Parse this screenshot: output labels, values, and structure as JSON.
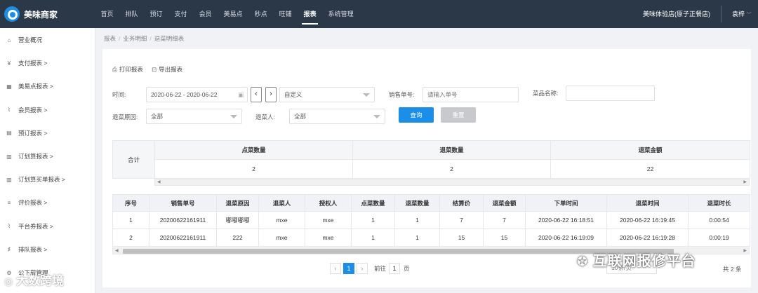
{
  "app": {
    "name": "美味商家"
  },
  "nav": [
    "首页",
    "排队",
    "预订",
    "支付",
    "会员",
    "美易点",
    "秒点",
    "旺铺",
    "报表",
    "系统管理"
  ],
  "nav_active": 8,
  "store_name": "美味体验店(原子正餐店)",
  "user_name": "袁梓",
  "sidebar": [
    {
      "icon": "home-icon",
      "glyph": "⌂",
      "label": "营业概况"
    },
    {
      "icon": "yen-icon",
      "glyph": "¥",
      "label": "支付报表 >"
    },
    {
      "icon": "grid-icon",
      "glyph": "▦",
      "label": "美易点报表 >"
    },
    {
      "icon": "line-chart-icon",
      "glyph": "⌇",
      "label": "会员报表 >"
    },
    {
      "icon": "calendar-icon",
      "glyph": "▤",
      "label": "预订报表 >"
    },
    {
      "icon": "bar-chart-icon",
      "glyph": "▥",
      "label": "订划算报表 >"
    },
    {
      "icon": "bar-chart-icon",
      "glyph": "▥",
      "label": "订划算买单报表 >"
    },
    {
      "icon": "list-icon",
      "glyph": "≡",
      "label": "评价报表 >"
    },
    {
      "icon": "trend-icon",
      "glyph": "⌇",
      "label": "平台券报表 >"
    },
    {
      "icon": "queue-icon",
      "glyph": "♯",
      "label": "排队报表 >"
    },
    {
      "icon": "settings-icon",
      "glyph": "⚙",
      "label": "公下载管理"
    }
  ],
  "breadcrumb": [
    "报表",
    "业务明细",
    "退菜明细表"
  ],
  "toolbar": {
    "print": "打印报表",
    "export": "导出报表"
  },
  "filters": {
    "time_label": "时间:",
    "date_range": "2020-06-22 - 2020-06-22",
    "period": "自定义",
    "order_label": "销售单号:",
    "order_placeholder": "请输入单号",
    "dish_label": "菜品名称:",
    "reason_label": "退菜原因:",
    "reason_value": "全部",
    "person_label": "退菜人:",
    "person_value": "全部",
    "query": "查询",
    "reset": "重置"
  },
  "summary": {
    "label": "合计",
    "headers": [
      "点菜数量",
      "退菜数量",
      "退菜金额"
    ],
    "values": [
      "2",
      "2",
      "22"
    ]
  },
  "detail": {
    "headers": [
      "序号",
      "销售单号",
      "退菜原因",
      "退菜人",
      "授权人",
      "点菜数量",
      "退菜数量",
      "结算价",
      "退菜金额",
      "下单时间",
      "退菜时间",
      "退菜时长"
    ],
    "rows": [
      [
        "1",
        "20200622161911",
        "嘟嘟嘟嘟",
        "mxe",
        "mxe",
        "1",
        "1",
        "7",
        "7",
        "2020-06-22 16:18:51",
        "2020-06-22 16:19:45",
        "0:00:54"
      ],
      [
        "2",
        "20200622161911",
        "222",
        "mxe",
        "mxe",
        "1",
        "1",
        "15",
        "15",
        "2020-06-22 16:19:09",
        "2020-06-22 16:19:28",
        "0:00:19"
      ]
    ]
  },
  "pager": {
    "current": "1",
    "goto_label": "前往",
    "goto_value": "1",
    "page_unit": "页",
    "total": "共 2 条",
    "page_size": "10条/页"
  },
  "watermarks": {
    "left": "大数跨境",
    "right": "互联网报修平台"
  },
  "colors": {
    "topbar": "#2b3848",
    "primary": "#1b8fe8",
    "reset_btn": "#c8c9cc"
  }
}
